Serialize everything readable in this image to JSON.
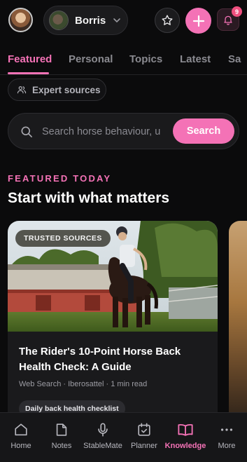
{
  "header": {
    "horse_name": "Borris",
    "notification_count": "9"
  },
  "tabs": [
    {
      "label": "Featured",
      "active": true
    },
    {
      "label": "Personal",
      "active": false
    },
    {
      "label": "Topics",
      "active": false
    },
    {
      "label": "Latest",
      "active": false
    },
    {
      "label": "Sa",
      "active": false
    }
  ],
  "expert_chip": {
    "label": "Expert sources",
    "icon": "users-icon"
  },
  "search": {
    "placeholder": "Search horse behaviour, u",
    "button_label": "Search"
  },
  "featured": {
    "eyebrow": "FEATURED TODAY",
    "title": "Start with what matters",
    "card": {
      "badge": "TRUSTED SOURCES",
      "title": "The Rider's 10-Point Horse Back Health Check: A Guide",
      "meta": "Web Search · Iberosattel · 1 min read",
      "tag": "Daily back health checklist"
    }
  },
  "bottom_nav": [
    {
      "label": "Home",
      "icon": "home-icon",
      "active": false
    },
    {
      "label": "Notes",
      "icon": "note-icon",
      "active": false
    },
    {
      "label": "StableMate",
      "icon": "microphone-icon",
      "active": false
    },
    {
      "label": "Planner",
      "icon": "calendar-check-icon",
      "active": false
    },
    {
      "label": "Knowledge",
      "icon": "book-open-icon",
      "active": true
    },
    {
      "label": "More",
      "icon": "more-dots-icon",
      "active": false
    }
  ],
  "colors": {
    "accent": "#f472b6",
    "background": "#0b0b0c",
    "surface": "#1a1a1c",
    "badge": "#ef4f7e"
  }
}
